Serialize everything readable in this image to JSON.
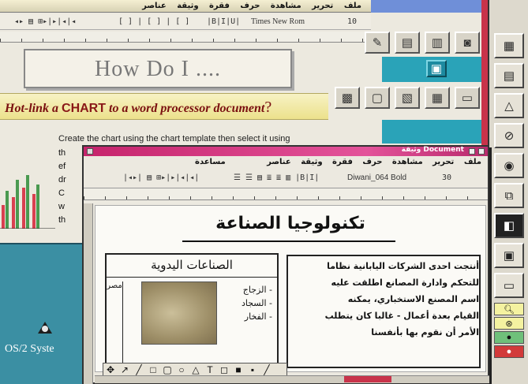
{
  "back_window": {
    "menu": [
      "ملف",
      "تحرير",
      "مشاهدة",
      "حرف",
      "فقرة",
      "وثيقة",
      "عناصر"
    ],
    "toolbar_font": "Times New Rom",
    "toolbar_size": "10",
    "heading": "How Do I ....",
    "hotlink_prefix": "Hot-link a",
    "hotlink_chart": "CHART",
    "hotlink_suffix": "to a word processor document",
    "hotlink_q": "?",
    "body_line1": "Create the chart using the chart template then select it using",
    "body_frag": [
      "th",
      "ef",
      "dr",
      "C",
      "w",
      "th"
    ]
  },
  "desktop": {
    "os2_label": "OS/2 Syste"
  },
  "front_window": {
    "title": "وثيقة Document",
    "menu": [
      "ملف",
      "تحرير",
      "مشاهدة",
      "حرف",
      "فقرة",
      "وثيقة",
      "عناصر",
      "مساعدة"
    ],
    "toolbar_font": "Diwani_064 Bold",
    "toolbar_size": "30",
    "doc_title": "تكنولوجيا الصناعة",
    "crafts_title": "الصناعات اليدوية",
    "crafts_items": [
      "- الزجاج",
      "- السجاد",
      "- الفخار"
    ],
    "crafts_country": "مصر",
    "article_lines": [
      "أنتجت احدى الشركات اليابانية نظاما",
      "للتحكم وادارة المصانع اطلقت عليه",
      "اسم المصنع الاستخباري، يمكنه",
      "القيام بعدة أعمال - غالبا كان يتطلب",
      "الأمر أن نقوم بها بأنفسنا"
    ]
  },
  "colors": {
    "desktop": "#2e8b9a",
    "titlebar_front": "#c6246c",
    "accent_red": "#c8334a",
    "hotlink_bg": "#ece18c"
  }
}
